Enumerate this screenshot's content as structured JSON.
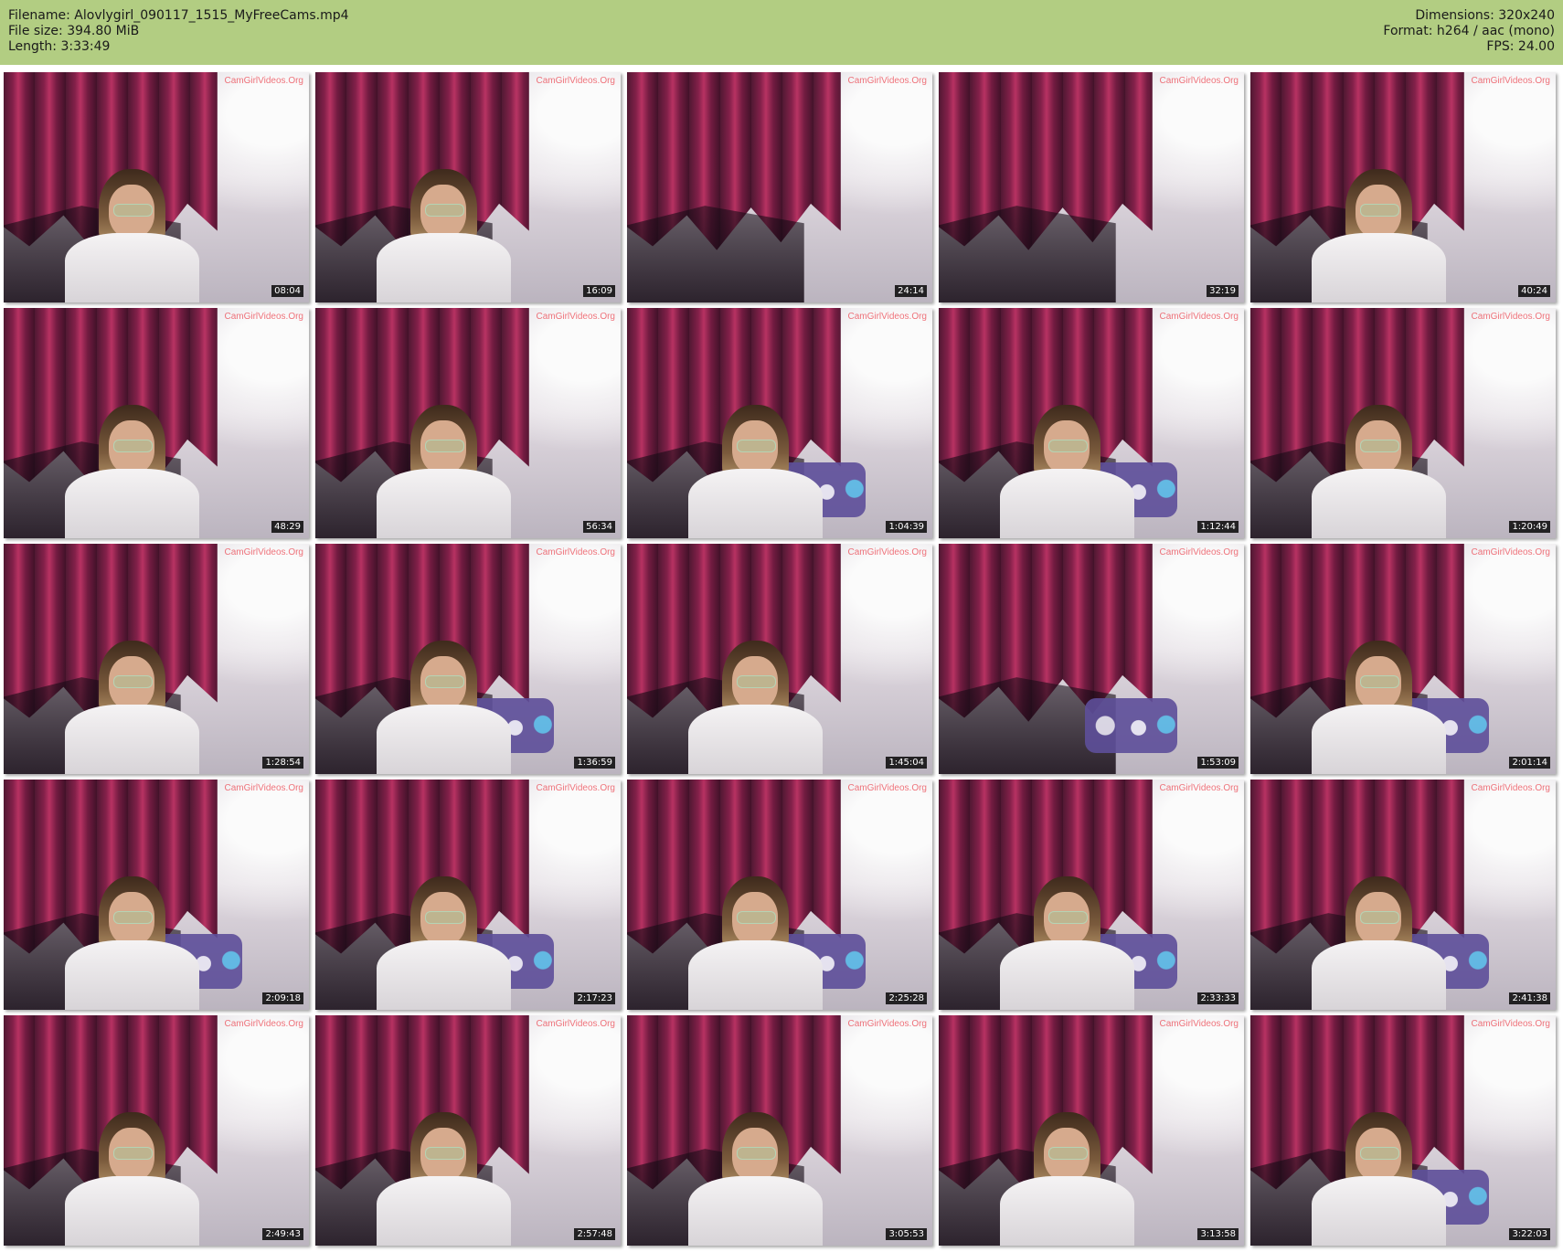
{
  "header": {
    "filename": "Filename: Alovlygirl_090117_1515_MyFreeCams.mp4",
    "filesize": "File size: 394.80 MiB",
    "length": "Length: 3:33:49",
    "dimensions": "Dimensions: 320x240",
    "format": "Format: h264 / aac (mono)",
    "fps": "FPS: 24.00"
  },
  "watermark": "CamGirlVideos.Org",
  "thumbnails": [
    {
      "time": "08:04"
    },
    {
      "time": "16:09"
    },
    {
      "time": "24:14"
    },
    {
      "time": "32:19"
    },
    {
      "time": "40:24"
    },
    {
      "time": "48:29"
    },
    {
      "time": "56:34"
    },
    {
      "time": "1:04:39"
    },
    {
      "time": "1:12:44"
    },
    {
      "time": "1:20:49"
    },
    {
      "time": "1:28:54"
    },
    {
      "time": "1:36:59"
    },
    {
      "time": "1:45:04"
    },
    {
      "time": "1:53:09"
    },
    {
      "time": "2:01:14"
    },
    {
      "time": "2:09:18"
    },
    {
      "time": "2:17:23"
    },
    {
      "time": "2:25:28"
    },
    {
      "time": "2:33:33"
    },
    {
      "time": "2:41:38"
    },
    {
      "time": "2:49:43"
    },
    {
      "time": "2:57:48"
    },
    {
      "time": "3:05:53"
    },
    {
      "time": "3:13:58"
    },
    {
      "time": "3:22:03"
    }
  ]
}
